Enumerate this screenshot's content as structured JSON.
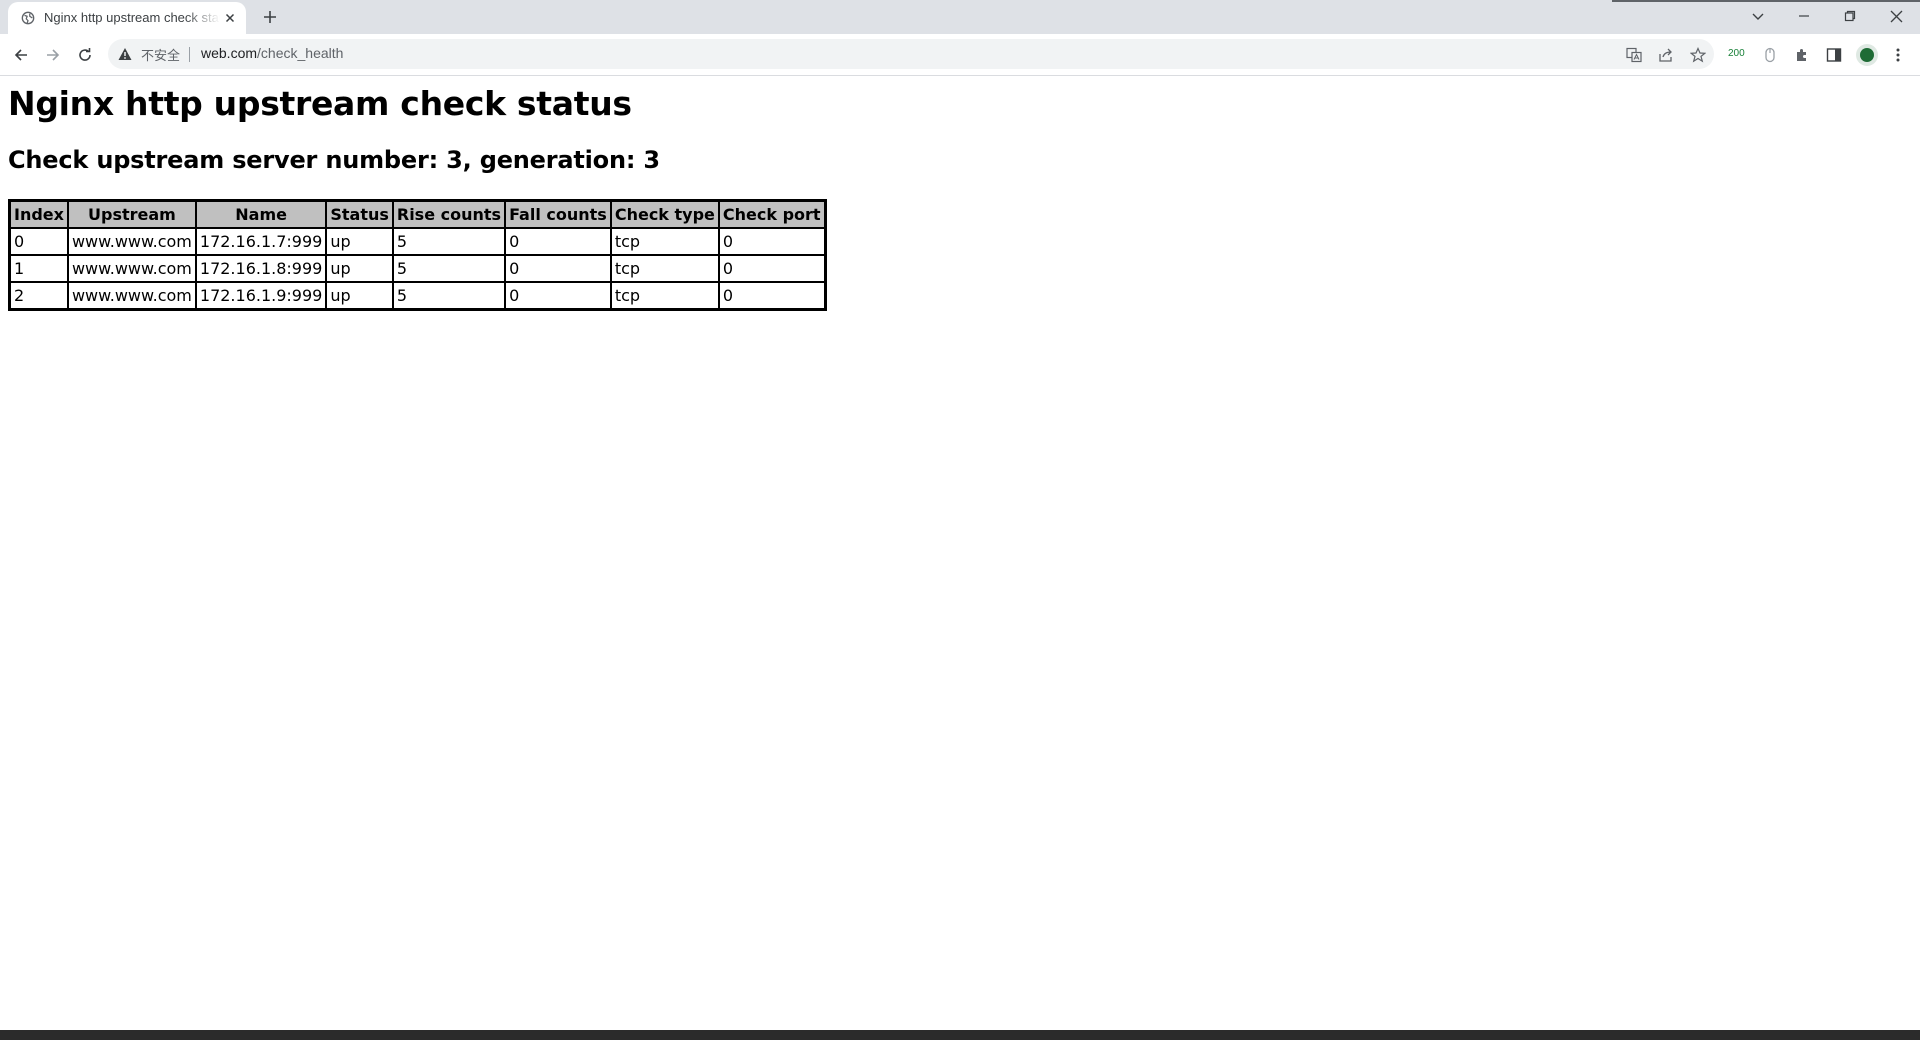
{
  "browser": {
    "tab": {
      "title": "Nginx http upstream check status"
    },
    "omnibox": {
      "security_label": "不安全",
      "url_host": "web.com",
      "url_path": "/check_health"
    },
    "extension_badge": "200"
  },
  "page": {
    "heading": "Nginx http upstream check status",
    "subheading": "Check upstream server number: 3, generation: 3",
    "table": {
      "headers": [
        "Index",
        "Upstream",
        "Name",
        "Status",
        "Rise counts",
        "Fall counts",
        "Check type",
        "Check port"
      ],
      "rows": [
        [
          "0",
          "www.www.com",
          "172.16.1.7:999",
          "up",
          "5",
          "0",
          "tcp",
          "0"
        ],
        [
          "1",
          "www.www.com",
          "172.16.1.8:999",
          "up",
          "5",
          "0",
          "tcp",
          "0"
        ],
        [
          "2",
          "www.www.com",
          "172.16.1.9:999",
          "up",
          "5",
          "0",
          "tcp",
          "0"
        ]
      ]
    }
  }
}
